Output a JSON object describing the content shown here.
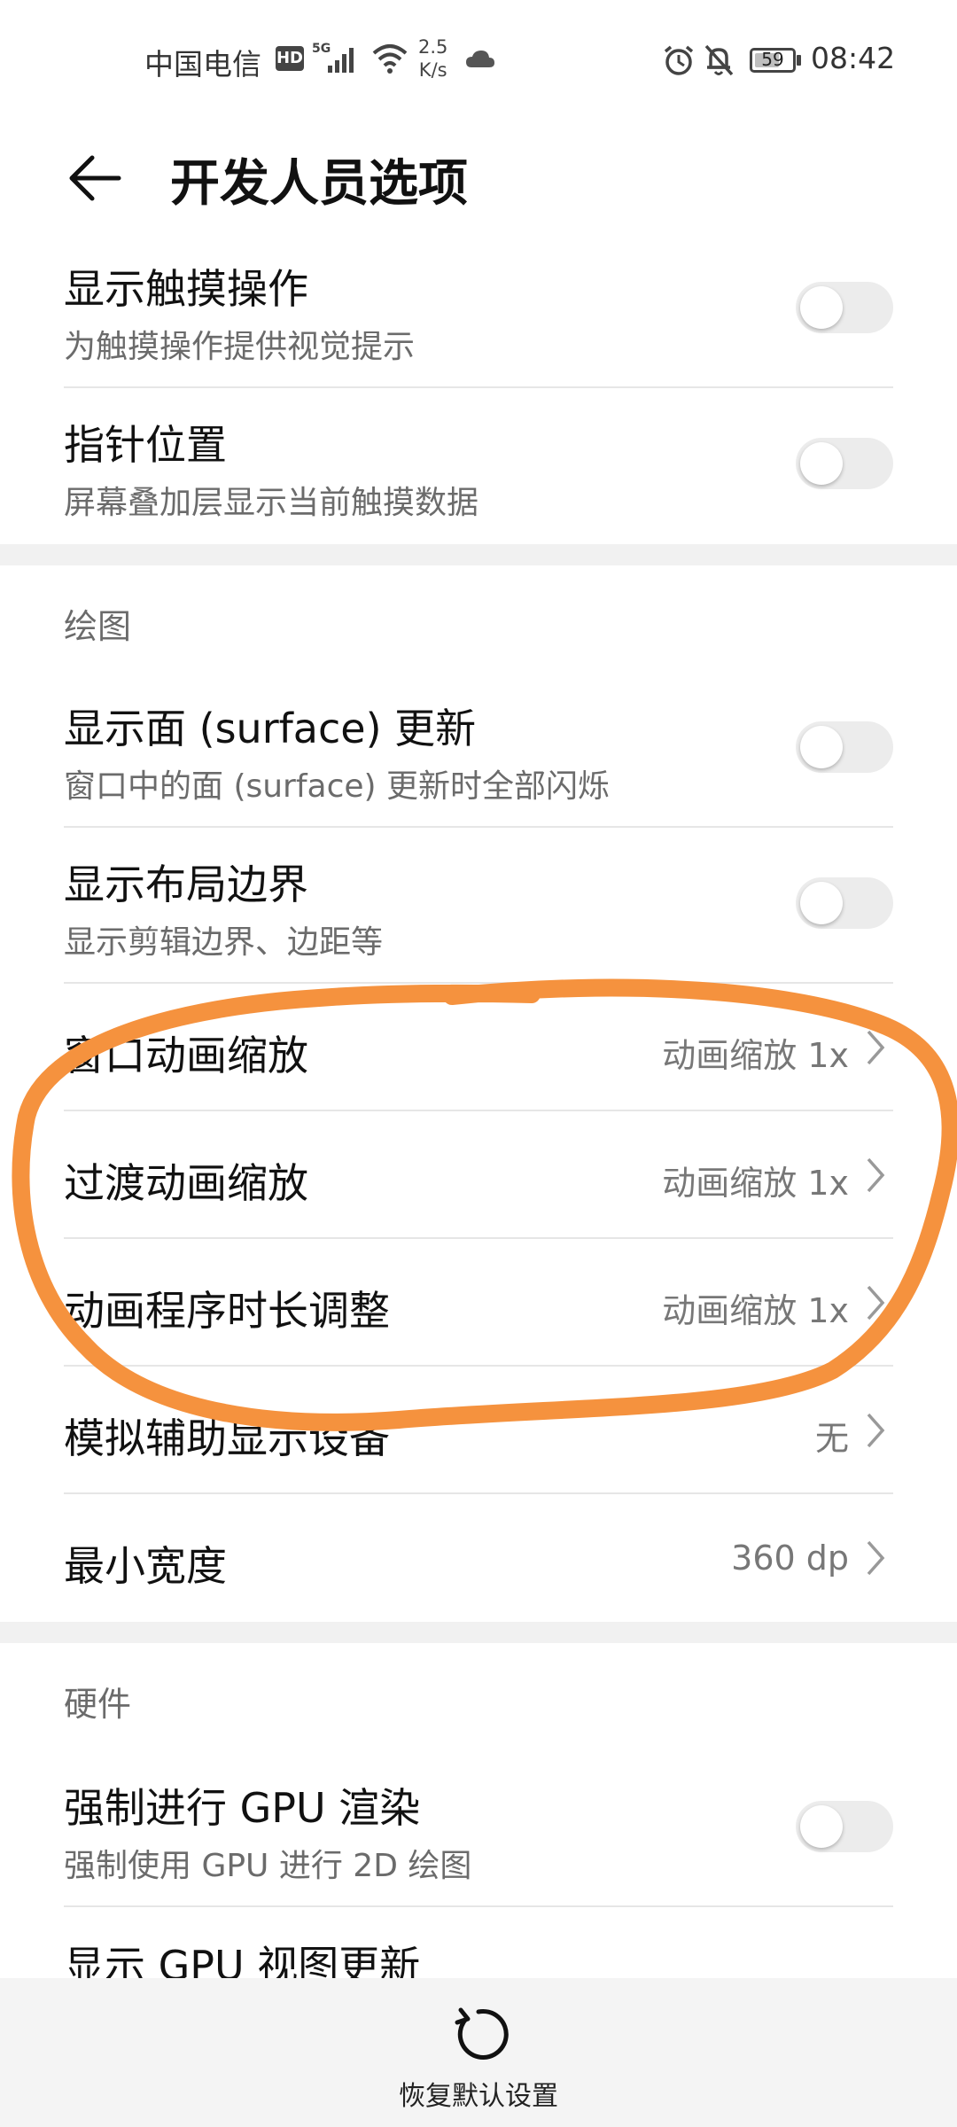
{
  "status_bar": {
    "carrier": "中国电信",
    "hd_badge": "HD",
    "network": "5G",
    "speed_value": "2.5",
    "speed_unit": "K/s",
    "battery_level": "59",
    "time": "08:42"
  },
  "header": {
    "title": "开发人员选项"
  },
  "rows": {
    "show_touches": {
      "title": "显示触摸操作",
      "subtitle": "为触摸操作提供视觉提示",
      "enabled": false
    },
    "pointer_location": {
      "title": "指针位置",
      "subtitle": "屏幕叠加层显示当前触摸数据",
      "enabled": false
    },
    "section_drawing": "绘图",
    "show_surface_updates": {
      "title": "显示面 (surface) 更新",
      "subtitle": "窗口中的面 (surface) 更新时全部闪烁",
      "enabled": false
    },
    "show_layout_bounds": {
      "title": "显示布局边界",
      "subtitle": "显示剪辑边界、边距等",
      "enabled": false
    },
    "window_animation_scale": {
      "title": "窗口动画缩放",
      "value": "动画缩放 1x"
    },
    "transition_animation_scale": {
      "title": "过渡动画缩放",
      "value": "动画缩放 1x"
    },
    "animator_duration_scale": {
      "title": "动画程序时长调整",
      "value": "动画缩放 1x"
    },
    "simulate_secondary_displays": {
      "title": "模拟辅助显示设备",
      "value": "无"
    },
    "smallest_width": {
      "title": "最小宽度",
      "value": "360 dp"
    },
    "section_hardware": "硬件",
    "force_gpu_rendering": {
      "title": "强制进行 GPU 渲染",
      "subtitle": "强制使用 GPU 进行 2D 绘图",
      "enabled": false
    },
    "show_gpu_view_updates": {
      "title": "显示 GPU 视图更新"
    }
  },
  "bottom_bar": {
    "restore_label": "恢复默认设置"
  },
  "colors": {
    "annotation_stroke": "#f5923e",
    "toggle_off": "#ececec",
    "divider": "#e6e6e6"
  }
}
